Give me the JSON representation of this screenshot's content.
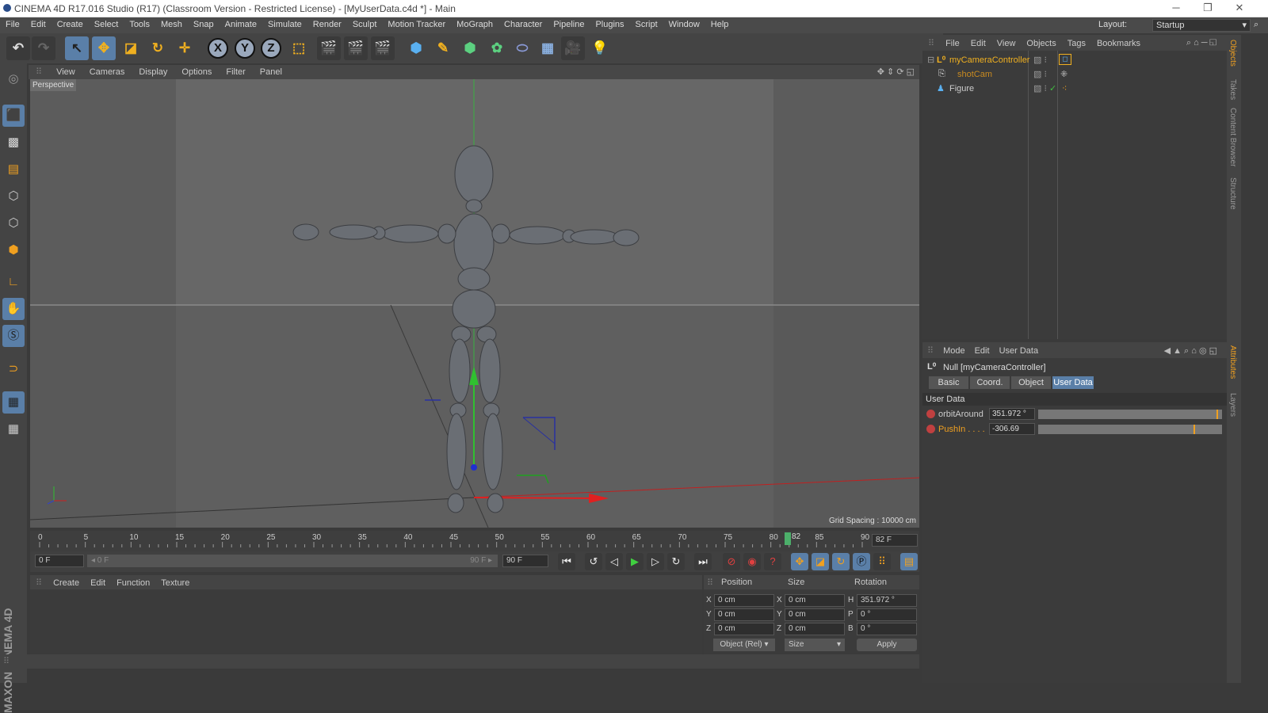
{
  "window": {
    "title": "CINEMA 4D R17.016 Studio (R17) (Classroom Version - Restricted License) - [MyUserData.c4d *] - Main",
    "min": "─",
    "max": "❐",
    "close": "✕"
  },
  "menu": [
    "File",
    "Edit",
    "Create",
    "Select",
    "Tools",
    "Mesh",
    "Snap",
    "Animate",
    "Simulate",
    "Render",
    "Sculpt",
    "Motion Tracker",
    "MoGraph",
    "Character",
    "Pipeline",
    "Plugins",
    "Script",
    "Window",
    "Help"
  ],
  "layout": {
    "label": "Layout:",
    "value": "Startup"
  },
  "axes": {
    "x": "X",
    "y": "Y",
    "z": "Z"
  },
  "viewport": {
    "menu": [
      "View",
      "Cameras",
      "Display",
      "Options",
      "Filter",
      "Panel"
    ],
    "label": "Perspective",
    "grid_spacing": "Grid Spacing : 10000 cm"
  },
  "timeline": {
    "ticks": [
      "0",
      "5",
      "10",
      "15",
      "20",
      "25",
      "30",
      "35",
      "40",
      "45",
      "50",
      "55",
      "60",
      "65",
      "70",
      "75",
      "80",
      "85",
      "90"
    ],
    "current_marker": "82",
    "current_frame": "82 F"
  },
  "transport": {
    "start": "0 F",
    "range_start": "◂ 0 F",
    "range_end": "90 F ▸",
    "end": "90 F"
  },
  "material_manager": {
    "menu": [
      "Create",
      "Edit",
      "Function",
      "Texture"
    ]
  },
  "coordinates": {
    "headers": {
      "position": "Position",
      "size": "Size",
      "rotation": "Rotation"
    },
    "rows": [
      {
        "pl": "X",
        "pv": "0 cm",
        "sl": "X",
        "sv": "0 cm",
        "rl": "H",
        "rv": "351.972 °"
      },
      {
        "pl": "Y",
        "pv": "0 cm",
        "sl": "Y",
        "sv": "0 cm",
        "rl": "P",
        "rv": "0 °"
      },
      {
        "pl": "Z",
        "pv": "0 cm",
        "sl": "Z",
        "sv": "0 cm",
        "rl": "B",
        "rv": "0 °"
      }
    ],
    "mode": "Object (Rel)",
    "size_mode": "Size",
    "apply": "Apply"
  },
  "brand": "MAXON CINEMA 4D",
  "object_manager": {
    "menu": [
      "File",
      "Edit",
      "View",
      "Objects",
      "Tags",
      "Bookmarks"
    ],
    "objects": [
      {
        "name": "myCameraController",
        "color": "#f0b020"
      },
      {
        "name": "shotCam",
        "color": "#c88a20"
      },
      {
        "name": "Figure",
        "color": "#cccccc"
      }
    ]
  },
  "attribute_manager": {
    "menu": [
      "Mode",
      "Edit",
      "User Data"
    ],
    "object_title": "Null [myCameraController]",
    "tabs": [
      "Basic",
      "Coord.",
      "Object",
      "User Data"
    ],
    "active_tab": "User Data",
    "section": "User Data",
    "fields": [
      {
        "label": "orbitAround",
        "value": "351.972 °",
        "fraction": 0.978,
        "color": "#cccccc"
      },
      {
        "label": "PushIn . . . .",
        "value": "-306.69",
        "fraction": 0.85,
        "color": "#f0a020"
      }
    ]
  },
  "side_tabs": [
    "Objects",
    "Takes",
    "Content Browser",
    "Structure",
    "Attributes",
    "Layers"
  ],
  "colors": {
    "accent": "#5a7fa8",
    "highlight": "#f0a020"
  }
}
